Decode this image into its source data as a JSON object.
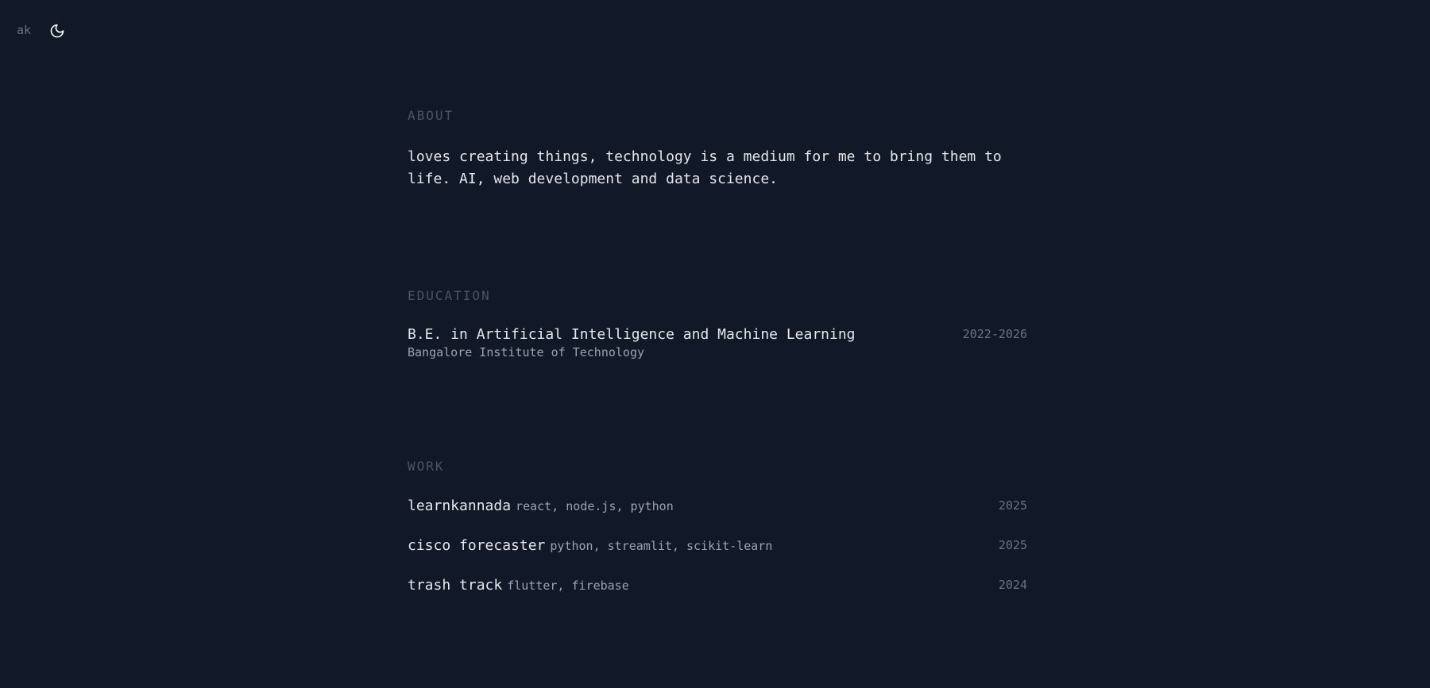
{
  "header": {
    "logo_text": "ak",
    "theme_toggle_icon": "moon-icon"
  },
  "about": {
    "title": "ABOUT",
    "text": "loves creating things, technology is a medium for me to bring them to life. AI, web development and data science."
  },
  "education": {
    "title": "EDUCATION",
    "items": [
      {
        "degree": "B.E. in Artificial Intelligence and Machine Learning",
        "school": "Bangalore Institute of Technology",
        "years": "2022-2026"
      }
    ]
  },
  "work": {
    "title": "WORK",
    "items": [
      {
        "name": "learnkannada",
        "tech": "react, node.js, python",
        "year": "2025"
      },
      {
        "name": "cisco forecaster",
        "tech": "python, streamlit, scikit-learn",
        "year": "2025"
      },
      {
        "name": "trash track",
        "tech": "flutter, firebase",
        "year": "2024"
      }
    ]
  },
  "colors": {
    "background": "#111827",
    "text": "#e5e7eb",
    "muted": "#9ca3af",
    "heading": "#4b5563"
  }
}
